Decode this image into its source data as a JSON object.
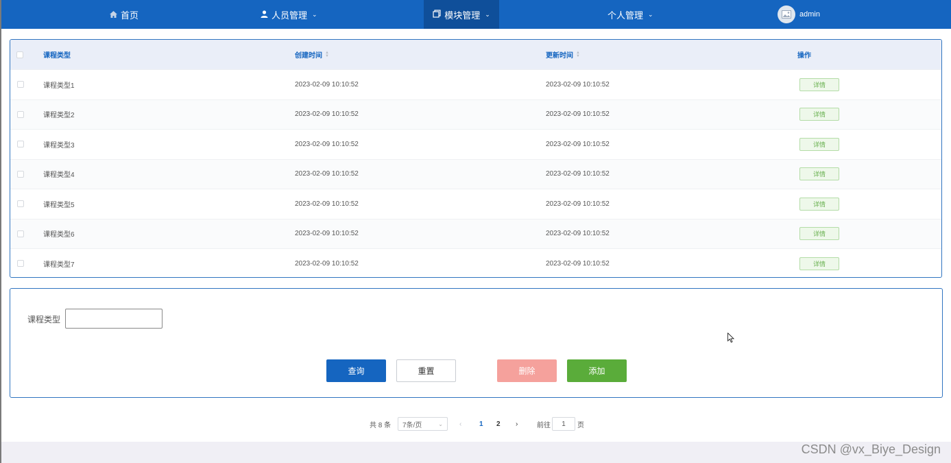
{
  "nav": {
    "home": "首页",
    "staff": "人员管理",
    "module": "模块管理",
    "personal": "个人管理",
    "user": "admin"
  },
  "table": {
    "headers": {
      "type": "课程类型",
      "created": "创建时间",
      "updated": "更新时间",
      "action": "操作"
    },
    "action_label": "详情",
    "rows": [
      {
        "type": "课程类型1",
        "created": "2023-02-09 10:10:52",
        "updated": "2023-02-09 10:10:52"
      },
      {
        "type": "课程类型2",
        "created": "2023-02-09 10:10:52",
        "updated": "2023-02-09 10:10:52"
      },
      {
        "type": "课程类型3",
        "created": "2023-02-09 10:10:52",
        "updated": "2023-02-09 10:10:52"
      },
      {
        "type": "课程类型4",
        "created": "2023-02-09 10:10:52",
        "updated": "2023-02-09 10:10:52"
      },
      {
        "type": "课程类型5",
        "created": "2023-02-09 10:10:52",
        "updated": "2023-02-09 10:10:52"
      },
      {
        "type": "课程类型6",
        "created": "2023-02-09 10:10:52",
        "updated": "2023-02-09 10:10:52"
      },
      {
        "type": "课程类型7",
        "created": "2023-02-09 10:10:52",
        "updated": "2023-02-09 10:10:52"
      }
    ]
  },
  "search": {
    "label": "课程类型",
    "value": "",
    "query": "查询",
    "reset": "重置",
    "delete": "删除",
    "add": "添加"
  },
  "pagination": {
    "total": "共 8 条",
    "page_size": "7条/页",
    "pages": [
      "1",
      "2"
    ],
    "current_page": "1",
    "goto_prefix": "前往",
    "goto_value": "1",
    "goto_suffix": "页"
  },
  "watermark": "CSDN @vx_Biye_Design",
  "colors": {
    "primary": "#1565c0",
    "danger": "#f5a19c",
    "success": "#5aac3a"
  }
}
